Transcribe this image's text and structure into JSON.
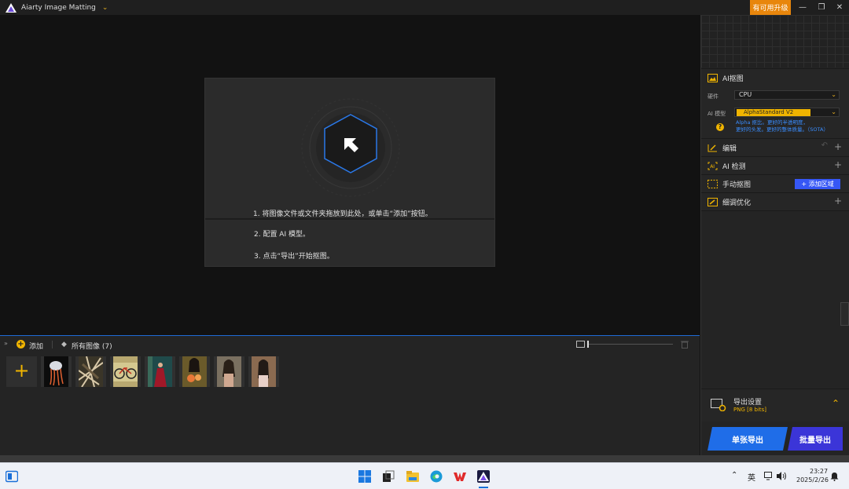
{
  "titlebar": {
    "app_title": "Aiarty Image Matting",
    "upgrade_label": "有可用升级"
  },
  "guide": {
    "step1": "1. 将图像文件或文件夹拖放到此处，或单击“添加”按钮。",
    "step2": "2. 配置 AI 模型。",
    "step3": "3. 点击“导出”开始抠图。"
  },
  "right_panel": {
    "matting_title": "AI抠图",
    "hardware_label": "硬件",
    "hardware_value": "CPU",
    "model_label": "AI 模型",
    "model_value": "AlphaStandard  V2",
    "model_desc_line1": "Alpha 抠比。更好的半透明度，",
    "model_desc_line2": "更好的头发。更好的整体质量。（SOTA）",
    "help_mark": "?",
    "edit_title": "编辑",
    "detect_title": "AI 检测",
    "manual_title": "手动抠图",
    "add_region_label": "添加区域",
    "refine_title": "细调优化",
    "export_settings_title": "导出设置",
    "export_format": "PNG   [8 bits]",
    "single_export_label": "单张导出",
    "batch_export_label": "批量导出"
  },
  "strip": {
    "add_label": "添加",
    "all_images_label": "所有图像 (7)",
    "thumb_count": 7
  },
  "taskbar": {
    "ime_label": "英",
    "time": "23:27",
    "date": "2025/2/26"
  },
  "colors": {
    "accent_orange": "#e8860c",
    "accent_yellow": "#f0b400",
    "single_export_blue": "#1f6de8",
    "batch_export_purple": "#3b35d8",
    "add_region_blue": "#3657f5",
    "hex_blue": "#2a78e8"
  }
}
